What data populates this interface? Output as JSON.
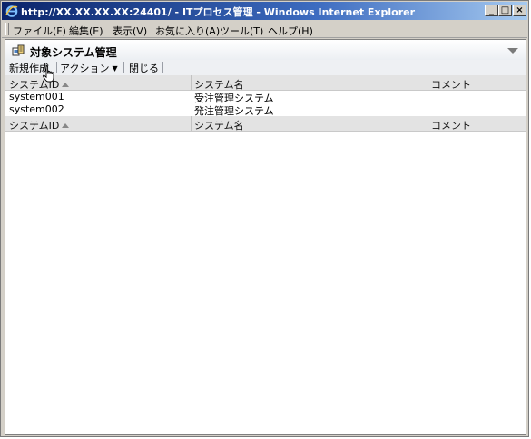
{
  "window": {
    "title": "http://XX.XX.XX.XX:24401/ - ITプロセス管理 - Windows Internet Explorer",
    "controls": {
      "minimize": "_",
      "restore": "□",
      "close": "×"
    }
  },
  "menubar": {
    "items": [
      {
        "label": "ファイル(F)"
      },
      {
        "label": "編集(E)"
      },
      {
        "label": "表示(V)"
      },
      {
        "label": "お気に入り(A)"
      },
      {
        "label": "ツール(T)"
      },
      {
        "label": "ヘルプ(H)"
      }
    ]
  },
  "panel": {
    "title": "対象システム管理",
    "toolbar": {
      "new_label": "新規作成",
      "action_label": "アクション",
      "close_label": "閉じる"
    }
  },
  "table": {
    "columns": [
      "システムID",
      "システム名",
      "コメント"
    ],
    "rows": [
      {
        "id": "system001",
        "name": "受注管理システム",
        "comment": ""
      },
      {
        "id": "system002",
        "name": "発注管理システム",
        "comment": ""
      }
    ]
  },
  "colors": {
    "titlebar_start": "#0a246a",
    "titlebar_end": "#a6caf0",
    "chrome": "#d4d0c8",
    "header_bg": "#e3e3e3"
  },
  "icons": {
    "browser": "ie-icon",
    "panel": "system-management-icon",
    "cursor": "hand-cursor-icon"
  }
}
